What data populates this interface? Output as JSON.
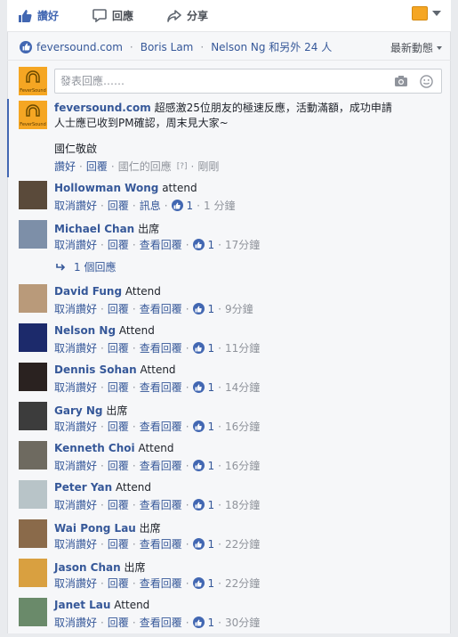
{
  "actions": {
    "like": "讚好",
    "comment": "回應",
    "share": "分享"
  },
  "likers": {
    "names": [
      "feversound.com",
      "Boris Lam",
      "Nelson Ng 和另外 24 人"
    ],
    "sort": "最新動態"
  },
  "composer": {
    "placeholder": "發表回應……"
  },
  "brand_avatar_text": "FeverSound",
  "main": {
    "name": "feversound.com",
    "text": "超感激25位朋友的極速反應，活動滿額，成功申請人士應已收到PM確認，周末見大家~",
    "sign": "國仁敬啟",
    "meta": {
      "like": "讚好",
      "reply": "回覆",
      "by": "國仁的回應",
      "help": "[?]",
      "time": "剛剛"
    }
  },
  "colors": {
    "brand": "#f5a623",
    "link": "#365899",
    "like_blue": "#4267b2"
  },
  "replies_label": "1 個回應",
  "comments": [
    {
      "name": "Hollowman Wong",
      "text": "attend",
      "unlike": "取消讚好",
      "reply": "回覆",
      "third": "訊息",
      "count": "1",
      "time": "1 分鐘",
      "av": "#5a4a3a"
    },
    {
      "name": "Michael Chan",
      "text": "出席",
      "unlike": "取消讚好",
      "reply": "回覆",
      "third": "查看回覆",
      "count": "1",
      "time": "17分鐘",
      "av": "#7d8fa8"
    },
    {
      "name": "David Fung",
      "text": "Attend",
      "unlike": "取消讚好",
      "reply": "回覆",
      "third": "查看回覆",
      "count": "1",
      "time": "9分鐘",
      "av": "#b99a7a"
    },
    {
      "name": "Nelson Ng",
      "text": "Attend",
      "unlike": "取消讚好",
      "reply": "回覆",
      "third": "查看回覆",
      "count": "1",
      "time": "11分鐘",
      "av": "#1c2a6b"
    },
    {
      "name": "Dennis Sohan",
      "text": "Attend",
      "unlike": "取消讚好",
      "reply": "回覆",
      "third": "查看回覆",
      "count": "1",
      "time": "14分鐘",
      "av": "#2a2220"
    },
    {
      "name": "Gary Ng",
      "text": "出席",
      "unlike": "取消讚好",
      "reply": "回覆",
      "third": "查看回覆",
      "count": "1",
      "time": "16分鐘",
      "av": "#3c3c3c"
    },
    {
      "name": "Kenneth Choi",
      "text": "Attend",
      "unlike": "取消讚好",
      "reply": "回覆",
      "third": "查看回覆",
      "count": "1",
      "time": "16分鐘",
      "av": "#6e6a60"
    },
    {
      "name": "Peter Yan",
      "text": "Attend",
      "unlike": "取消讚好",
      "reply": "回覆",
      "third": "查看回覆",
      "count": "1",
      "time": "18分鐘",
      "av": "#b8c4c8"
    },
    {
      "name": "Wai Pong Lau",
      "text": "出席",
      "unlike": "取消讚好",
      "reply": "回覆",
      "third": "查看回覆",
      "count": "1",
      "time": "22分鐘",
      "av": "#8a6a4a"
    },
    {
      "name": "Jason Chan",
      "text": "出席",
      "unlike": "取消讚好",
      "reply": "回覆",
      "third": "查看回覆",
      "count": "1",
      "time": "22分鐘",
      "av": "#d9a040"
    },
    {
      "name": "Janet Lau",
      "text": "Attend",
      "unlike": "取消讚好",
      "reply": "回覆",
      "third": "查看回覆",
      "count": "1",
      "time": "30分鐘",
      "av": "#6a8a6a"
    }
  ]
}
